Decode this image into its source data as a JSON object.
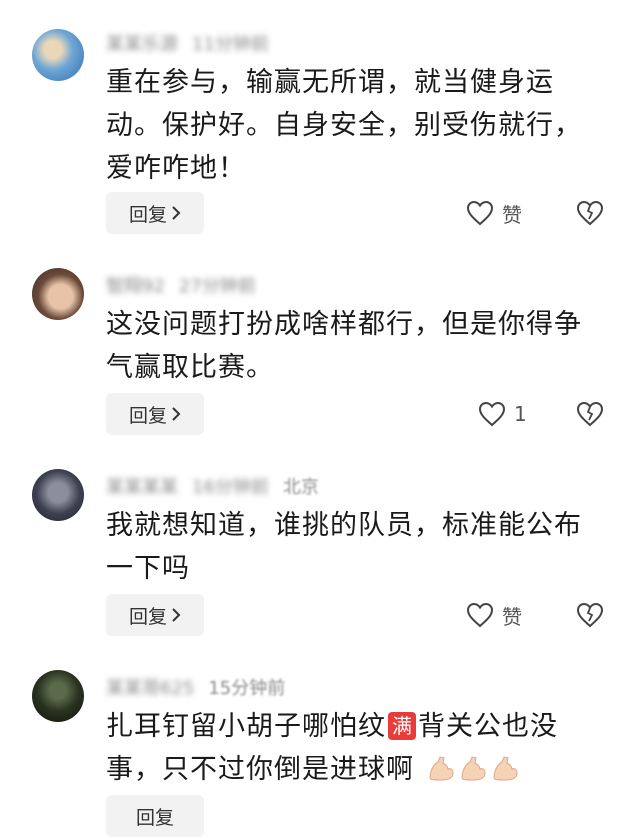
{
  "comments": [
    {
      "author": "某某乐源",
      "time": "11分钟前",
      "location": "",
      "text_lines": [
        "重在参与，输赢无所谓，就当健身运",
        "动。保护好。自身安全，别受伤就行，",
        "爱咋咋地！"
      ],
      "reply_label": "回复",
      "like_label": "赞"
    },
    {
      "author": "智翔92",
      "time": "27分钟前",
      "location": "",
      "text_lines": [
        "这没问题打扮成啥样都行，但是你得争",
        "气赢取比赛。"
      ],
      "reply_label": "回复",
      "like_label": "1"
    },
    {
      "author": "某某某某",
      "time": "16分钟前",
      "location": "北京",
      "text_lines": [
        "我就想知道，谁挑的队员，标准能公布",
        "一下吗"
      ],
      "reply_label": "回复",
      "like_label": "赞"
    },
    {
      "author": "某某哥625",
      "time": "15分钟前",
      "location": "",
      "text_line1_before": "扎耳钉留小胡子哪怕纹",
      "text_badge": "满",
      "text_line1_after": "背关公也没",
      "text_line2": "事，只不过你倒是进球啊",
      "reply_label": "回复"
    }
  ],
  "icons": {
    "like": "heart-outline-icon",
    "dislike": "broken-heart-icon",
    "reply_chevron": "chevron-right-icon",
    "emoji": "flexed-biceps-emoji"
  },
  "colors": {
    "badge": "#ea3b3b",
    "reply_bg": "#f2f2f2",
    "meta": "#9a9a9a"
  }
}
